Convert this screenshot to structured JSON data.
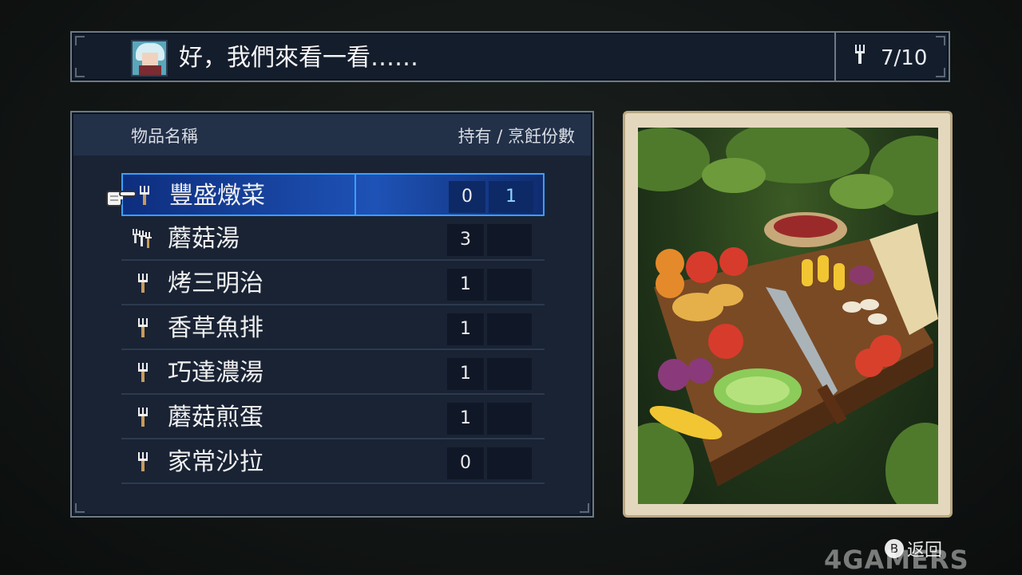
{
  "dialog": {
    "message": "好，我們來看一看……",
    "counter_icon": "fork-icon",
    "counter": "7/10"
  },
  "list": {
    "header_name": "物品名稱",
    "header_right": "持有 / 烹飪份數",
    "items": [
      {
        "icon": "fork-icon",
        "name": "豐盛燉菜",
        "owned": "0",
        "cook": "1",
        "selected": true
      },
      {
        "icon": "triple-fork-icon",
        "name": "蘑菇湯",
        "owned": "3",
        "cook": ""
      },
      {
        "icon": "fork-icon",
        "name": "烤三明治",
        "owned": "1",
        "cook": ""
      },
      {
        "icon": "fork-icon",
        "name": "香草魚排",
        "owned": "1",
        "cook": ""
      },
      {
        "icon": "fork-icon",
        "name": "巧達濃湯",
        "owned": "1",
        "cook": ""
      },
      {
        "icon": "fork-icon",
        "name": "蘑菇煎蛋",
        "owned": "1",
        "cook": ""
      },
      {
        "icon": "fork-icon",
        "name": "家常沙拉",
        "owned": "0",
        "cook": ""
      }
    ]
  },
  "footer": {
    "back_button_glyph": "B",
    "back_label": "返回"
  },
  "watermark": "4GAMERS"
}
